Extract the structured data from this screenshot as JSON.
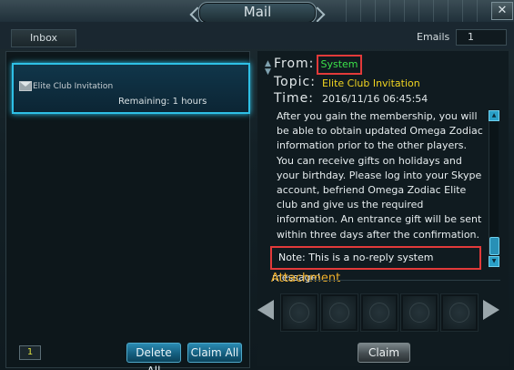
{
  "window": {
    "title": "Mail"
  },
  "tabs": {
    "inbox_label": "Inbox"
  },
  "emails": {
    "label": "Emails",
    "count": "1"
  },
  "mail_list": {
    "items": [
      {
        "subject": "Elite Club Invitation",
        "remaining": "Remaining: 1 hours",
        "selected": true
      }
    ],
    "page": "1"
  },
  "buttons": {
    "delete_all": "Delete All",
    "claim_all": "Claim All",
    "claim": "Claim"
  },
  "message": {
    "from_label": "From:",
    "from_value": "System",
    "topic_label": "Topic:",
    "topic_value": "Elite Club Invitation",
    "time_label": "Time:",
    "time_value": "2016/11/16 06:45:54",
    "body": "After you gain the membership, you will be able to obtain updated Omega Zodiac information prior to the other players. You can receive gifts on holidays and your birthday. Please log into your Skype account, befriend Omega Zodiac Elite club and give us the required information. An entrance gift will be sent within three days after the confirmation.",
    "note": "Note: This is a no-reply system message!"
  },
  "attachment": {
    "label": "Attachment"
  },
  "colors": {
    "selection_border": "#2ec0e6",
    "highlight_box": "#e23a3a",
    "from_text": "#3be24a",
    "topic_text": "#f0d420",
    "attachment_label": "#f0b02a",
    "page_number": "#dfe040"
  },
  "icons": [
    "close-icon",
    "envelope-icon",
    "sort-arrow-icon",
    "scroll-up-icon",
    "scroll-down-icon",
    "arrow-left-icon",
    "arrow-right-icon"
  ]
}
